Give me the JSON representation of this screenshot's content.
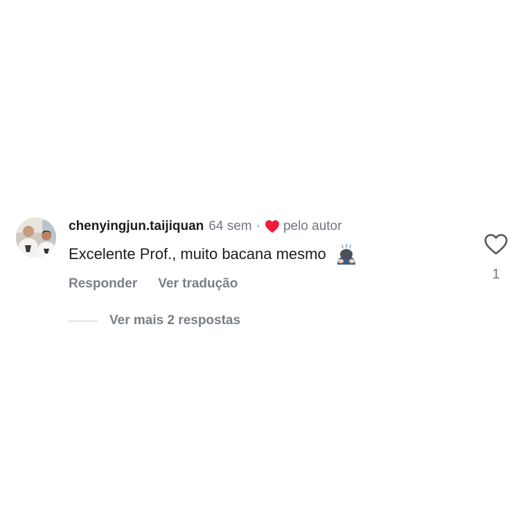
{
  "comment": {
    "username": "chenyingjun.taijiquan",
    "timestamp": "64 sem",
    "separator": "·",
    "liked_by_author_label": "pelo autor",
    "text": "Excelente Prof., muito bacana mesmo",
    "emoji": "person-bowing-emoji",
    "actions": {
      "reply_label": "Responder",
      "translate_label": "Ver tradução"
    },
    "like_count": "1"
  },
  "replies": {
    "label": "Ver mais 2 respostas"
  },
  "colors": {
    "heart_red": "#ed1c3a",
    "muted_text": "#73777d",
    "primary_text": "#1c1c1c"
  },
  "icons": {
    "like": "heart-outline-icon",
    "author_like": "heart-filled-icon"
  }
}
